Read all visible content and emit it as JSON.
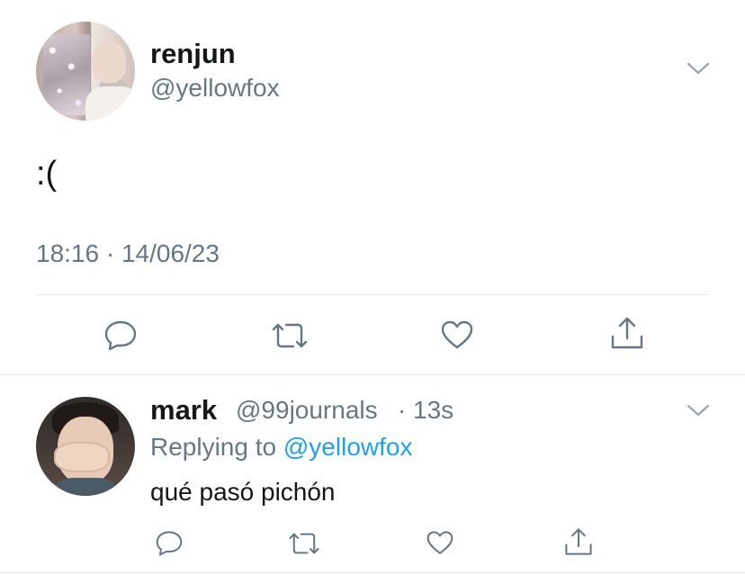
{
  "main_tweet": {
    "display_name": "renjun",
    "handle": "@yellowfox",
    "text": ":(",
    "timestamp": "18:16 · 14/06/23",
    "actions": [
      "reply-icon",
      "retweet-icon",
      "like-icon",
      "share-icon"
    ]
  },
  "reply_tweet": {
    "display_name": "mark",
    "handle": "@99journals",
    "separator": "·",
    "time": "13s",
    "replying_prefix": "Replying to",
    "replying_mention": "@yellowfox",
    "text": "qué pasó pichón",
    "actions": [
      "reply-icon",
      "retweet-icon",
      "like-icon",
      "share-icon"
    ]
  },
  "colors": {
    "primary_text": "#14171a",
    "secondary_text": "#657786",
    "link": "#1da1f2",
    "divider": "#e1e8ed",
    "icon": "#657786"
  }
}
